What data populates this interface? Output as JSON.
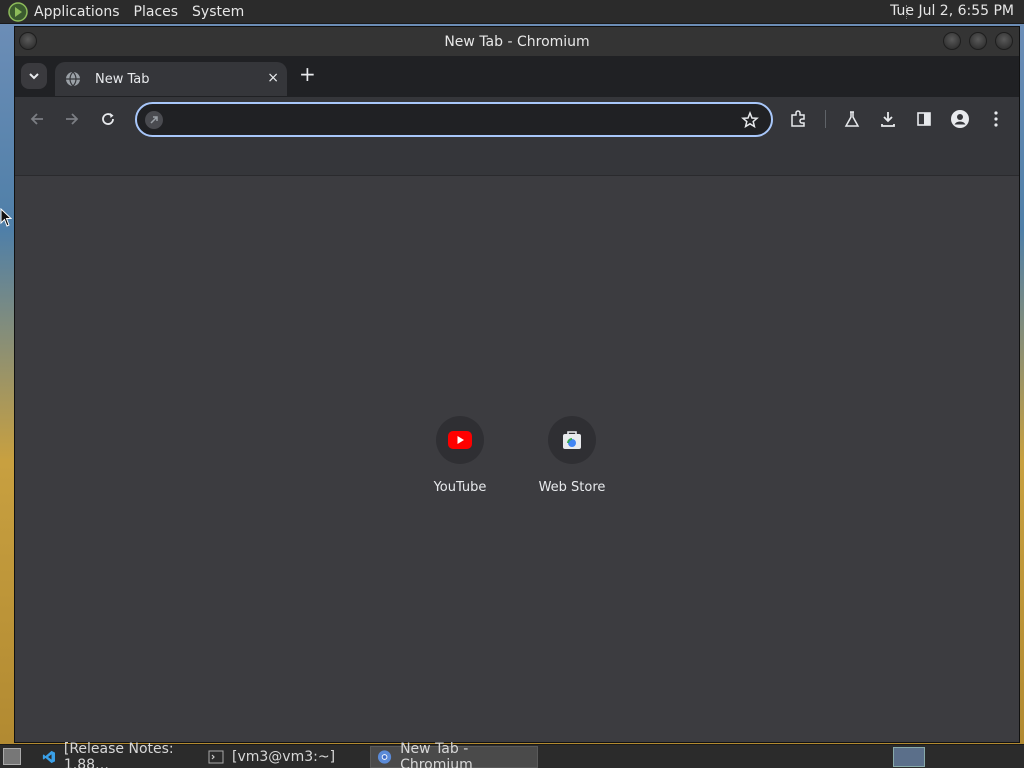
{
  "top_panel": {
    "menus": [
      "Applications",
      "Places",
      "System"
    ],
    "clock": "Tue Jul  2,  6:55 PM"
  },
  "window": {
    "title": "New Tab - Chromium"
  },
  "tabs": [
    {
      "title": "New Tab",
      "close": "×"
    }
  ],
  "new_tab_label": "+",
  "omnibox": {
    "value": "",
    "placeholder": ""
  },
  "shortcuts": [
    {
      "label": "YouTube",
      "icon": "youtube-icon",
      "color": "#ff0000"
    },
    {
      "label": "Web Store",
      "icon": "web-store-icon",
      "color": "#4285f4"
    }
  ],
  "taskbar": [
    {
      "label": "[Release Notes: 1.88…",
      "icon": "vscode-icon",
      "active": false
    },
    {
      "label": "[vm3@vm3:~]",
      "icon": "terminal-icon",
      "active": false
    },
    {
      "label": "New Tab - Chromium",
      "icon": "chromium-icon",
      "active": true
    }
  ],
  "colors": {
    "accent": "#a8c7fa",
    "content_bg": "#3c3c40",
    "toolbar_bg": "#35363a"
  }
}
